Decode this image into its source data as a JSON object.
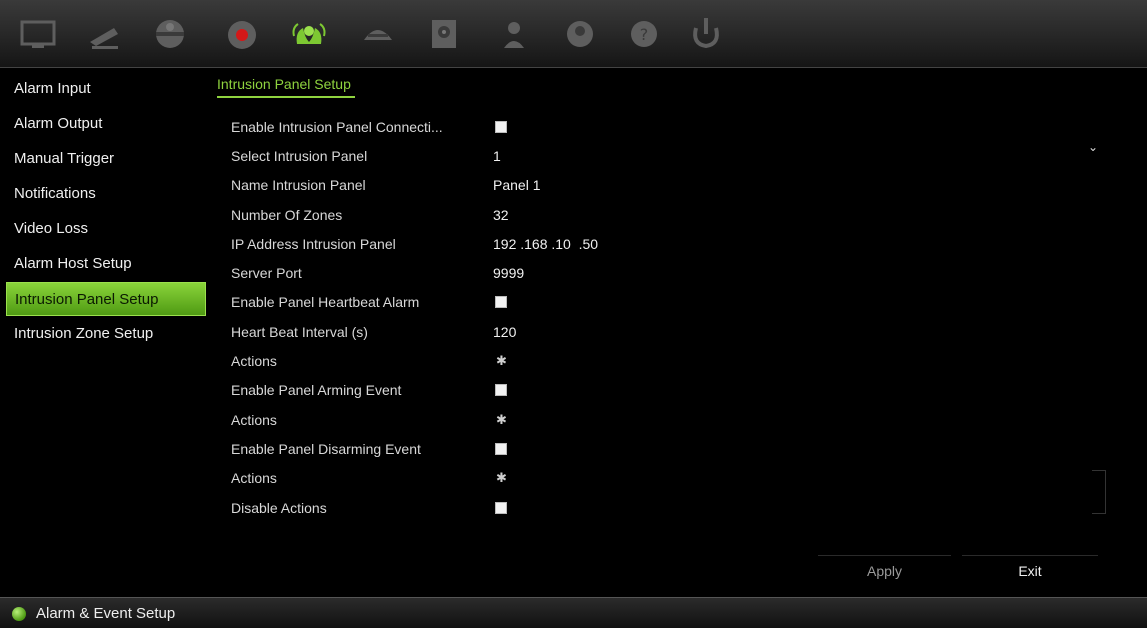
{
  "toolbar": {
    "icons": [
      "monitor-icon",
      "camera-icon",
      "ptz-dome-icon",
      "record-icon",
      "alarm-icon",
      "network-icon",
      "storage-icon",
      "user-icon",
      "device-icon",
      "help-icon",
      "power-icon"
    ],
    "active_color": "#7dc832"
  },
  "sidebar": {
    "items": [
      {
        "label": "Alarm Input"
      },
      {
        "label": "Alarm Output"
      },
      {
        "label": "Manual Trigger"
      },
      {
        "label": "Notifications"
      },
      {
        "label": "Video Loss"
      },
      {
        "label": "Alarm Host Setup"
      },
      {
        "label": "Intrusion Panel Setup"
      },
      {
        "label": "Intrusion Zone Setup"
      }
    ],
    "active_index": 6
  },
  "panel": {
    "title": "Intrusion Panel Setup",
    "rows": [
      {
        "label": "Enable Intrusion Panel Connecti...",
        "type": "checkbox",
        "checked": false
      },
      {
        "label": "Select Intrusion Panel",
        "type": "select",
        "value": "1"
      },
      {
        "label": "Name Intrusion Panel",
        "type": "text",
        "value": "Panel 1"
      },
      {
        "label": "Number Of Zones",
        "type": "text",
        "value": "32"
      },
      {
        "label": "IP Address Intrusion Panel",
        "type": "ip",
        "value": "192 .168 .10  .50"
      },
      {
        "label": "Server Port",
        "type": "text",
        "value": "9999"
      },
      {
        "label": "Enable Panel Heartbeat Alarm",
        "type": "checkbox",
        "checked": false
      },
      {
        "label": "Heart Beat Interval (s)",
        "type": "text",
        "value": "120"
      },
      {
        "label": "Actions",
        "type": "gear"
      },
      {
        "label": "Enable Panel Arming Event",
        "type": "checkbox",
        "checked": false
      },
      {
        "label": "Actions",
        "type": "gear"
      },
      {
        "label": "Enable Panel Disarming Event",
        "type": "checkbox",
        "checked": false
      },
      {
        "label": "Actions",
        "type": "gear"
      },
      {
        "label": "Disable Actions",
        "type": "checkbox",
        "checked": false
      }
    ]
  },
  "buttons": {
    "apply": "Apply",
    "exit": "Exit"
  },
  "status": {
    "text": "Alarm & Event Setup"
  }
}
